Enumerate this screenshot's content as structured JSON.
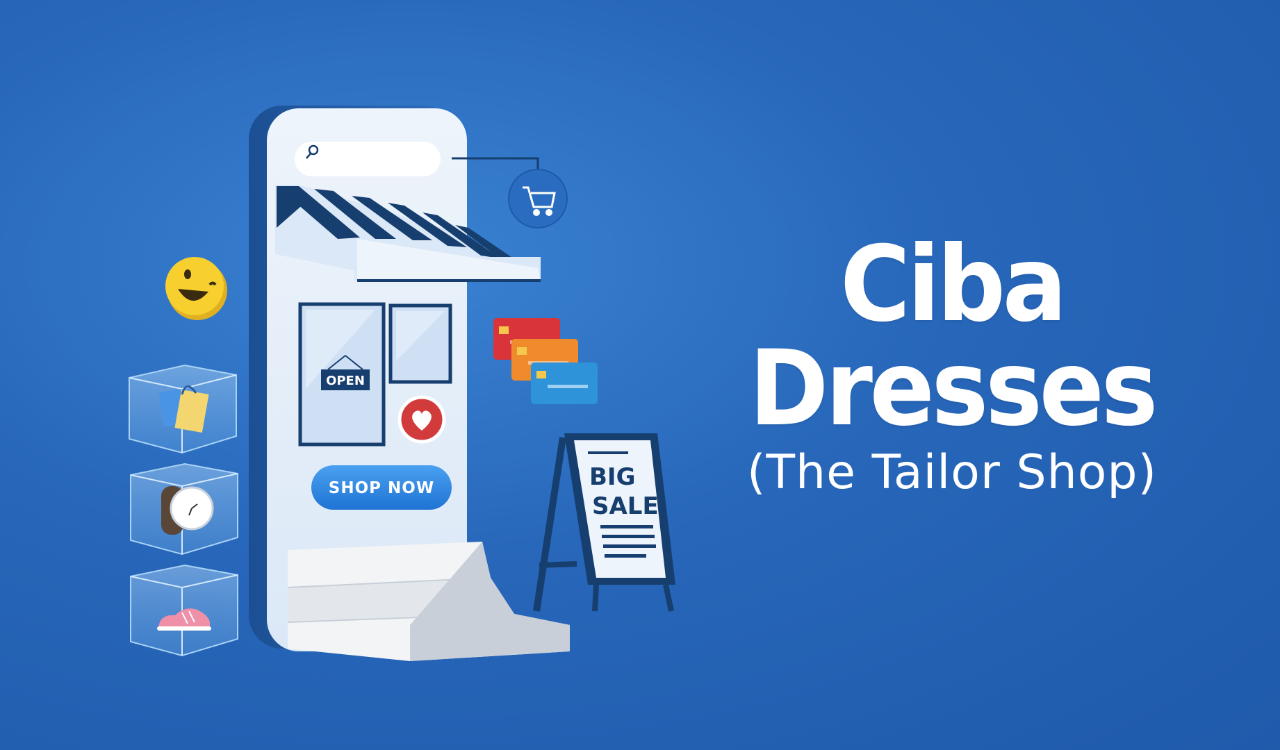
{
  "brand": {
    "name": "Ciba Dresses",
    "tagline": "(The Tailor Shop)"
  },
  "phone": {
    "open_sign": "OPEN",
    "cta_label": "SHOP NOW"
  },
  "sale_sign": {
    "line1": "BIG",
    "line2": "SALE"
  },
  "colors": {
    "background": "#2766b9",
    "accent": "#2f86e6",
    "navy": "#163e6e",
    "white": "#ffffff"
  },
  "icons": [
    "search-icon",
    "cart-icon",
    "smiley-icon",
    "heart-icon",
    "shopping-bag-icon",
    "wristwatch-icon",
    "sneaker-icon",
    "credit-card-icon"
  ]
}
